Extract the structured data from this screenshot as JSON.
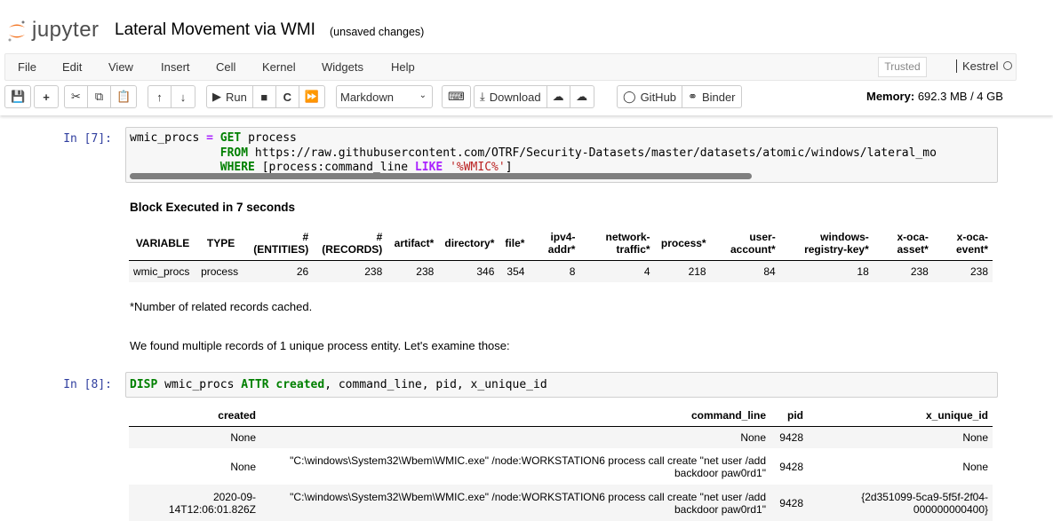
{
  "header": {
    "logo_text": "jupyter",
    "notebook_title": "Lateral Movement via WMI",
    "save_status": "(unsaved changes)"
  },
  "menu": [
    "File",
    "Edit",
    "View",
    "Insert",
    "Cell",
    "Kernel",
    "Widgets",
    "Help"
  ],
  "trusted": "Trusted",
  "kernel_name": "Kestrel",
  "toolbar": {
    "run": "Run",
    "cell_type": "Markdown",
    "download": "Download",
    "github": "GitHub",
    "binder": "Binder"
  },
  "memory": {
    "label": "Memory:",
    "value": "692.3 MB / 4 GB"
  },
  "cell7": {
    "prompt": "In [7]:",
    "var": "wmic_procs",
    "eq": "=",
    "get": "GET",
    "entity": "process",
    "from": "FROM",
    "url": "https://raw.githubusercontent.com/OTRF/Security-Datasets/master/datasets/atomic/windows/lateral_mo",
    "where": "WHERE",
    "cond": "[process:command_line",
    "like": "LIKE",
    "pattern": "'%WMIC%'",
    "close": "]"
  },
  "output7": {
    "executed": "Block Executed in 7 seconds",
    "headers": [
      [
        "VARIABLE"
      ],
      [
        "TYPE"
      ],
      [
        "#",
        "(ENTITIES)"
      ],
      [
        "#",
        "(RECORDS)"
      ],
      [
        "artifact*"
      ],
      [
        "directory*"
      ],
      [
        "file*"
      ],
      [
        "ipv4-",
        "addr*"
      ],
      [
        "network-",
        "traffic*"
      ],
      [
        "process*"
      ],
      [
        "user-",
        "account*"
      ],
      [
        "windows-",
        "registry-key*"
      ],
      [
        "x-oca-",
        "asset*"
      ],
      [
        "x-oca-",
        "event*"
      ]
    ],
    "row": [
      "wmic_procs",
      "process",
      "26",
      "238",
      "238",
      "346",
      "354",
      "8",
      "4",
      "218",
      "84",
      "18",
      "238",
      "238"
    ],
    "footnote": "*Number of related records cached.",
    "message": "We found multiple records of 1 unique process entity. Let's examine those:"
  },
  "cell8": {
    "prompt": "In [8]:",
    "disp": "DISP",
    "var": "wmic_procs",
    "attr": "ATTR",
    "created": "created",
    "rest": ", command_line, pid, x_unique_id"
  },
  "output8": {
    "headers": [
      "created",
      "command_line",
      "pid",
      "x_unique_id"
    ],
    "rows": [
      [
        "None",
        "None",
        "9428",
        "None"
      ],
      [
        "None",
        "\"C:\\windows\\System32\\Wbem\\WMIC.exe\" /node:WORKSTATION6 process call create \"net user /add backdoor paw0rd1\"",
        "9428",
        "None"
      ],
      [
        "2020-09-14T12:06:01.826Z",
        "\"C:\\windows\\System32\\Wbem\\WMIC.exe\" /node:WORKSTATION6 process call create \"net user /add backdoor paw0rd1\"",
        "9428",
        "{2d351099-5ca9-5f5f-2f04-000000000400}"
      ]
    ]
  }
}
